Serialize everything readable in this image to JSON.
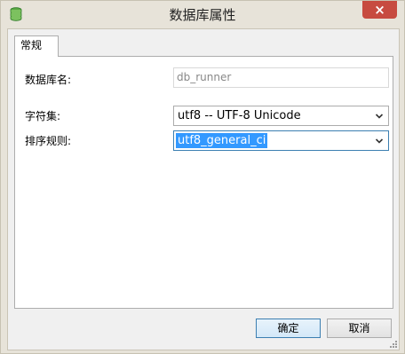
{
  "window": {
    "title": "数据库属性",
    "close_symbol": "×"
  },
  "tabs": [
    {
      "label": "常规",
      "selected": true
    }
  ],
  "form": {
    "db_name_label": "数据库名:",
    "db_name_value": "db_runner",
    "charset_label": "字符集:",
    "charset_value": "utf8 -- UTF-8 Unicode",
    "collation_label": "排序规则:",
    "collation_value": "utf8_general_ci"
  },
  "buttons": {
    "ok": "确定",
    "cancel": "取消"
  },
  "icons": {
    "app": "database-icon",
    "close": "close-icon",
    "dropdown": "chevron-down-icon",
    "resize": "resize-grip-icon"
  },
  "colors": {
    "close_button": "#c74b40",
    "selection": "#3399ff",
    "focus_border": "#3c7fb1"
  }
}
